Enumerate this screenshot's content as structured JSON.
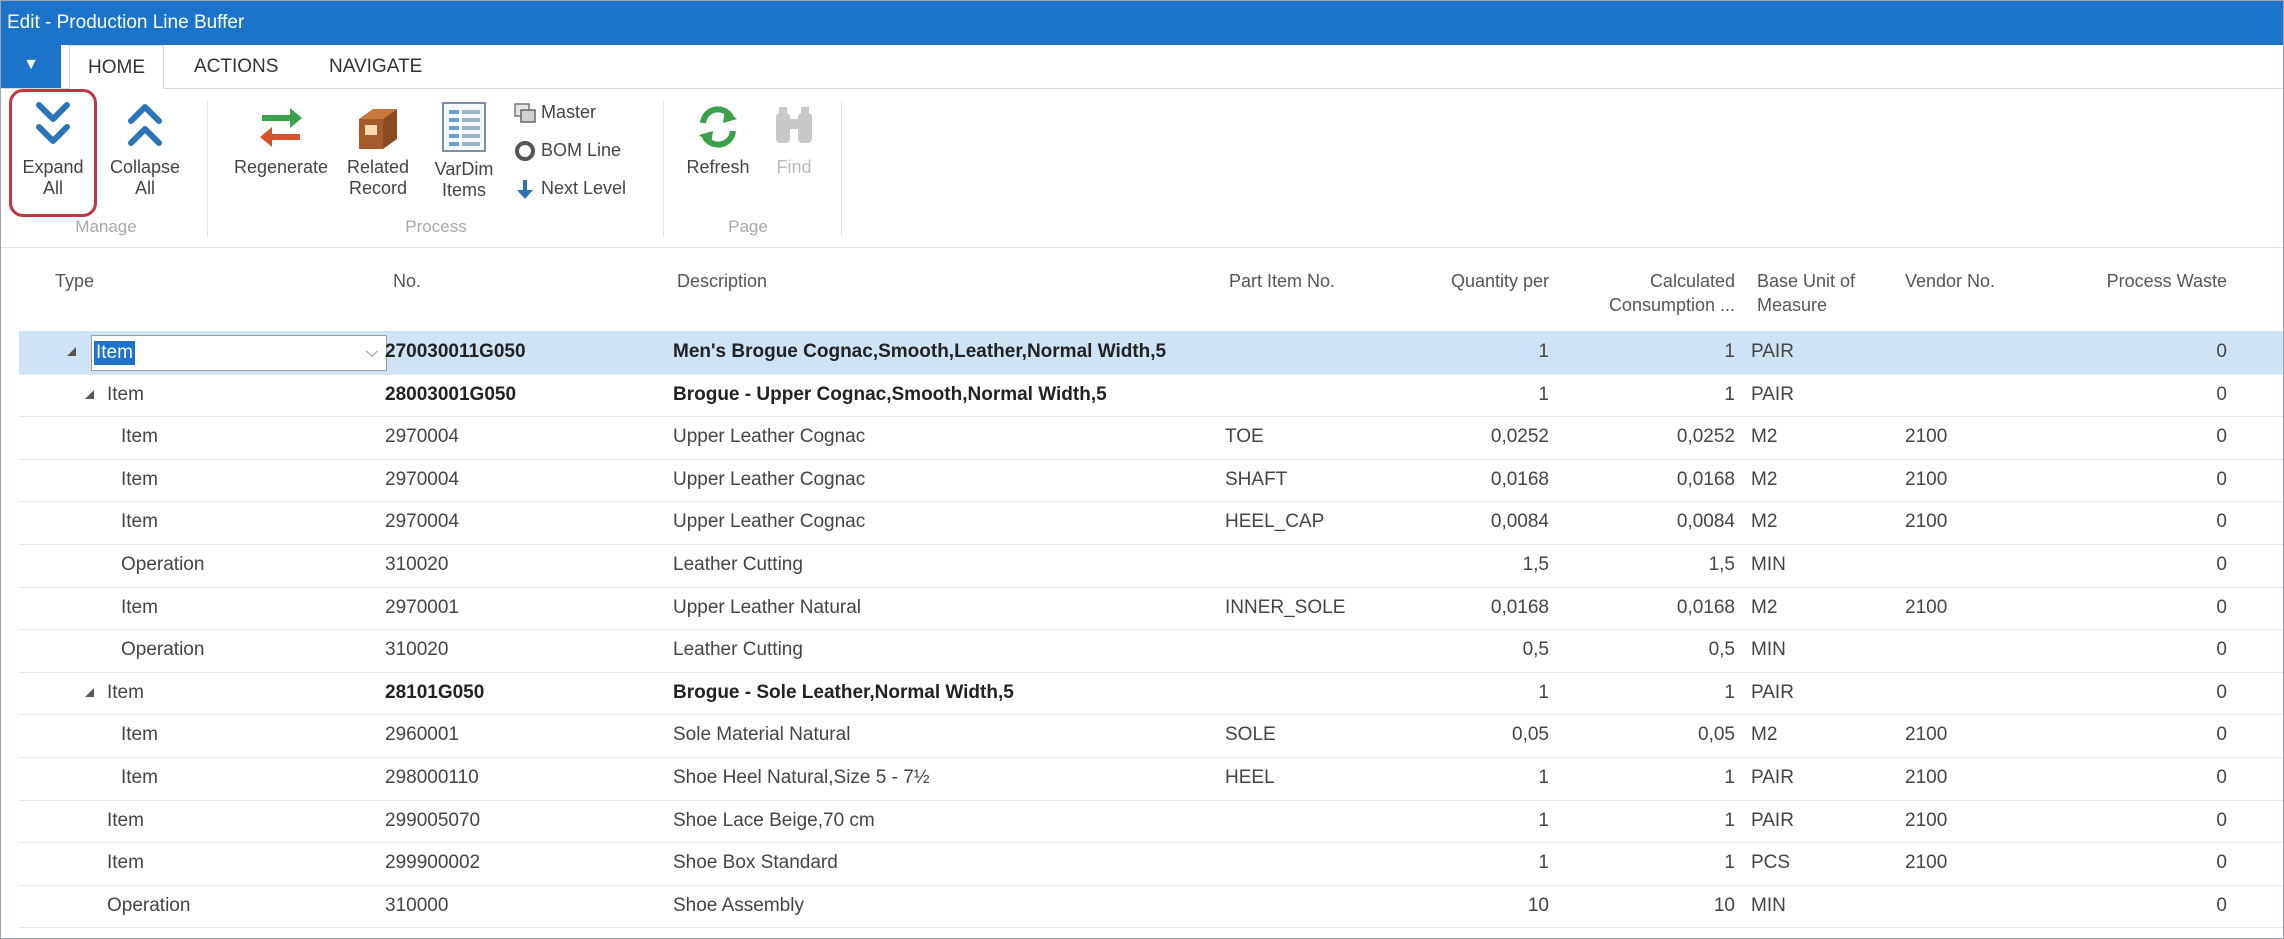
{
  "window": {
    "title": "Edit - Production Line Buffer"
  },
  "tabs": [
    {
      "label": "HOME"
    },
    {
      "label": "ACTIONS"
    },
    {
      "label": "NAVIGATE"
    }
  ],
  "ribbon": {
    "manage": {
      "label": "Manage",
      "expand_all": {
        "line1": "Expand",
        "line2": "All"
      },
      "collapse_all": {
        "line1": "Collapse",
        "line2": "All"
      }
    },
    "process": {
      "label": "Process",
      "regenerate": "Regenerate",
      "related_record": {
        "line1": "Related",
        "line2": "Record"
      },
      "vardim_items": {
        "line1": "VarDim",
        "line2": "Items"
      },
      "master": "Master",
      "bom_line": "BOM Line",
      "next_level": "Next Level"
    },
    "page": {
      "label": "Page",
      "refresh": "Refresh",
      "find": "Find"
    }
  },
  "columns": {
    "type": "Type",
    "no": "No.",
    "description": "Description",
    "part_item_no": "Part Item No.",
    "quantity_per": "Quantity per",
    "calc_consumption_1": "Calculated",
    "calc_consumption_2": "Consumption ...",
    "base_uom_1": "Base Unit of",
    "base_uom_2": "Measure",
    "vendor_no": "Vendor No.",
    "process_waste": "Process Waste"
  },
  "rows": [
    {
      "type": "Item",
      "no": "270030011G050",
      "desc": "Men's Brogue Cognac,Smooth,Leather,Normal Width,5",
      "part": "",
      "qty": "1",
      "calc": "1",
      "uom": "PAIR",
      "vendor": "",
      "waste": "0"
    },
    {
      "type": "Item",
      "no": "28003001G050",
      "desc": "Brogue - Upper Cognac,Smooth,Normal Width,5",
      "part": "",
      "qty": "1",
      "calc": "1",
      "uom": "PAIR",
      "vendor": "",
      "waste": "0"
    },
    {
      "type": "Item",
      "no": "2970004",
      "desc": "Upper Leather Cognac",
      "part": "TOE",
      "qty": "0,0252",
      "calc": "0,0252",
      "uom": "M2",
      "vendor": "2100",
      "waste": "0"
    },
    {
      "type": "Item",
      "no": "2970004",
      "desc": "Upper Leather Cognac",
      "part": "SHAFT",
      "qty": "0,0168",
      "calc": "0,0168",
      "uom": "M2",
      "vendor": "2100",
      "waste": "0"
    },
    {
      "type": "Item",
      "no": "2970004",
      "desc": "Upper Leather Cognac",
      "part": "HEEL_CAP",
      "qty": "0,0084",
      "calc": "0,0084",
      "uom": "M2",
      "vendor": "2100",
      "waste": "0"
    },
    {
      "type": "Operation",
      "no": "310020",
      "desc": "Leather Cutting",
      "part": "",
      "qty": "1,5",
      "calc": "1,5",
      "uom": "MIN",
      "vendor": "",
      "waste": "0"
    },
    {
      "type": "Item",
      "no": "2970001",
      "desc": "Upper Leather Natural",
      "part": "INNER_SOLE",
      "qty": "0,0168",
      "calc": "0,0168",
      "uom": "M2",
      "vendor": "2100",
      "waste": "0"
    },
    {
      "type": "Operation",
      "no": "310020",
      "desc": "Leather Cutting",
      "part": "",
      "qty": "0,5",
      "calc": "0,5",
      "uom": "MIN",
      "vendor": "",
      "waste": "0"
    },
    {
      "type": "Item",
      "no": "28101G050",
      "desc": "Brogue - Sole Leather,Normal Width,5",
      "part": "",
      "qty": "1",
      "calc": "1",
      "uom": "PAIR",
      "vendor": "",
      "waste": "0"
    },
    {
      "type": "Item",
      "no": "2960001",
      "desc": "Sole Material Natural",
      "part": "SOLE",
      "qty": "0,05",
      "calc": "0,05",
      "uom": "M2",
      "vendor": "2100",
      "waste": "0"
    },
    {
      "type": "Item",
      "no": "298000110",
      "desc": "Shoe Heel Natural,Size 5 - 7½",
      "part": "HEEL",
      "qty": "1",
      "calc": "1",
      "uom": "PAIR",
      "vendor": "2100",
      "waste": "0"
    },
    {
      "type": "Item",
      "no": "299005070",
      "desc": "Shoe Lace Beige,70 cm",
      "part": "",
      "qty": "1",
      "calc": "1",
      "uom": "PAIR",
      "vendor": "2100",
      "waste": "0"
    },
    {
      "type": "Item",
      "no": "299900002",
      "desc": "Shoe Box Standard",
      "part": "",
      "qty": "1",
      "calc": "1",
      "uom": "PCS",
      "vendor": "2100",
      "waste": "0"
    },
    {
      "type": "Operation",
      "no": "310000",
      "desc": "Shoe Assembly",
      "part": "",
      "qty": "10",
      "calc": "10",
      "uom": "MIN",
      "vendor": "",
      "waste": "0"
    }
  ]
}
